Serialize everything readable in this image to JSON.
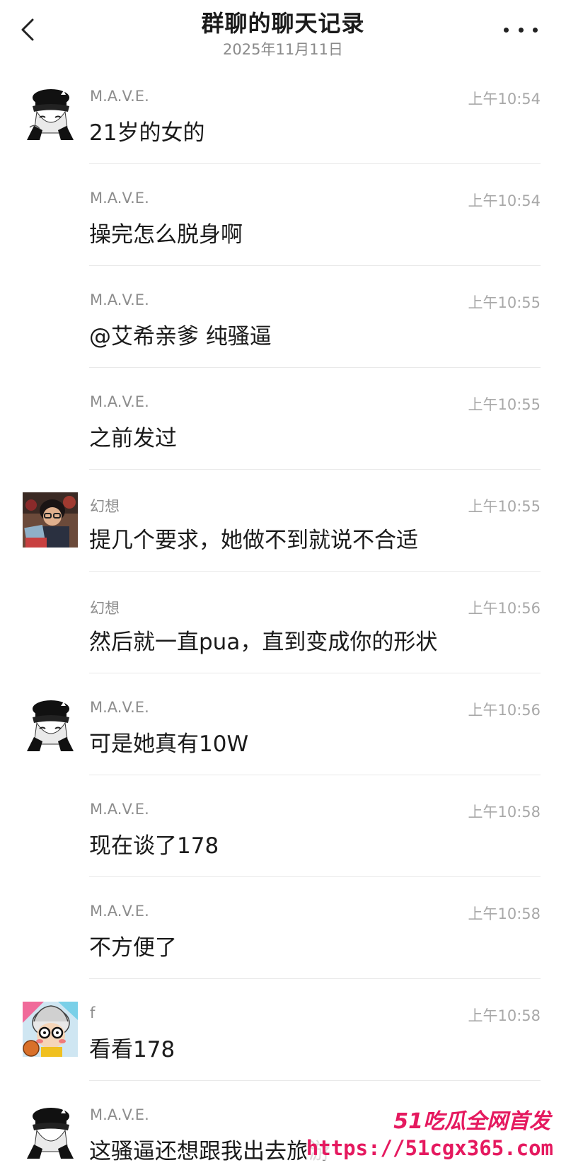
{
  "header": {
    "title": "群聊的聊天记录",
    "date": "2025年11月11日"
  },
  "messages": [
    {
      "sender": "M.A.V.E.",
      "time": "上午10:54",
      "text": "21岁的女的",
      "avatar": "black-hat-anime-avatar"
    },
    {
      "sender": "M.A.V.E.",
      "time": "上午10:54",
      "text": "操完怎么脱身啊",
      "avatar": ""
    },
    {
      "sender": "M.A.V.E.",
      "time": "上午10:55",
      "text": "@艾希亲爹 纯骚逼",
      "avatar": ""
    },
    {
      "sender": "M.A.V.E.",
      "time": "上午10:55",
      "text": "之前发过",
      "avatar": ""
    },
    {
      "sender": "幻想",
      "time": "上午10:55",
      "text": "提几个要求，她做不到就说不合适",
      "avatar": "child-reading-photo-avatar"
    },
    {
      "sender": "幻想",
      "time": "上午10:56",
      "text": "然后就一直pua，直到变成你的形状",
      "avatar": ""
    },
    {
      "sender": "M.A.V.E.",
      "time": "上午10:56",
      "text": "可是她真有10W",
      "avatar": "black-hat-anime-avatar"
    },
    {
      "sender": "M.A.V.E.",
      "time": "上午10:58",
      "text": "现在谈了178",
      "avatar": ""
    },
    {
      "sender": "M.A.V.E.",
      "time": "上午10:58",
      "text": "不方便了",
      "avatar": ""
    },
    {
      "sender": "f",
      "time": "上午10:58",
      "text": "看看178",
      "avatar": "glasses-cartoon-avatar"
    },
    {
      "sender": "M.A.V.E.",
      "time": "",
      "text": "这骚逼还想跟我出去旅游",
      "avatar": "black-hat-anime-avatar"
    }
  ],
  "watermark": {
    "line1": "51吃瓜全网首发",
    "line2": "https://51cgx365.com"
  },
  "colors": {
    "watermark": "#e5195f",
    "sender": "#8d8d8d",
    "time": "#a8a8a8"
  }
}
